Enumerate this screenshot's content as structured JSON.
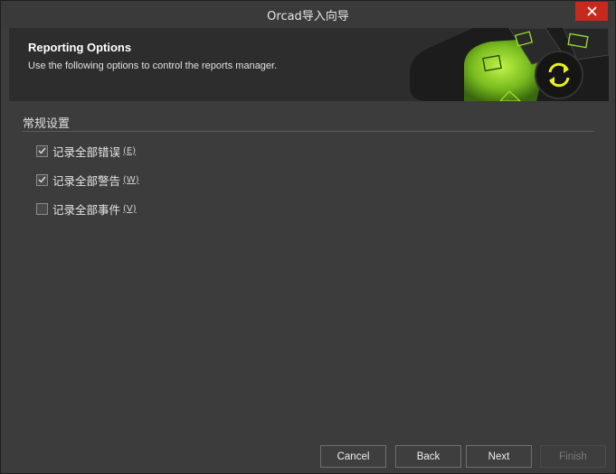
{
  "window": {
    "title": "Orcad导入向导"
  },
  "header": {
    "title": "Reporting Options",
    "subtitle": "Use the following options to control the reports manager."
  },
  "section": {
    "title": "常规设置"
  },
  "options": [
    {
      "label": "记录全部错误",
      "accelerator": "(E)",
      "checked": true
    },
    {
      "label": "记录全部警告",
      "accelerator": "(W)",
      "checked": true
    },
    {
      "label": "记录全部事件",
      "accelerator": "(V)",
      "checked": false
    }
  ],
  "buttons": {
    "cancel": "Cancel",
    "back": "Back",
    "next": "Next",
    "finish": "Finish"
  },
  "colors": {
    "close": "#c42b1c",
    "accent_green": "#9be22d"
  },
  "icons": [
    "close-icon",
    "check-icon",
    "refresh-icon"
  ]
}
